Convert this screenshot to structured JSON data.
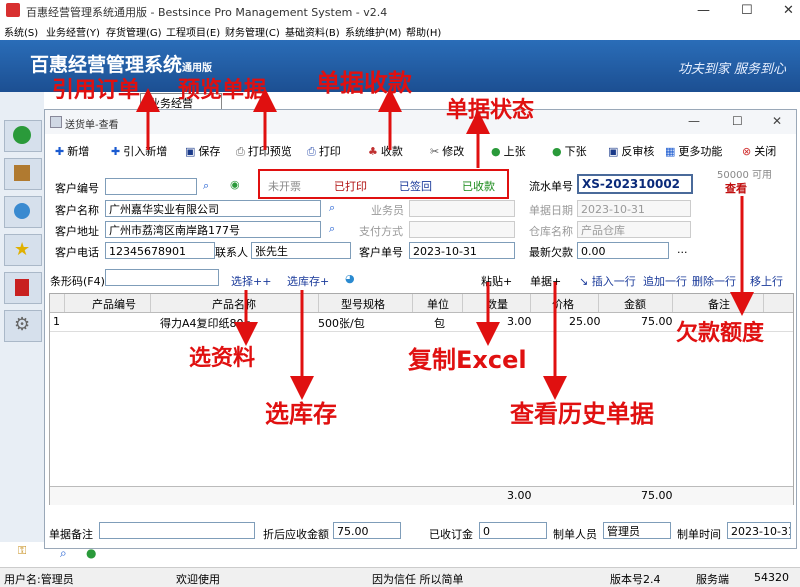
{
  "outer_window": {
    "title": "百惠经营管理系统通用版 - Bestsince Pro Management System - v2.4",
    "menu": [
      "系统(S)",
      "业务经营(Y)",
      "存货管理(G)",
      "工程项目(E)",
      "财务管理(C)",
      "基础资料(B)",
      "系统维护(M)",
      "帮助(H)"
    ],
    "banner_title": "百惠经营管理系统",
    "banner_subtitle": "通用版",
    "slogan": "功夫到家 服务到心",
    "mdi_tab": "业务经营"
  },
  "inner_window": {
    "title": "送货单-查看",
    "toolbar": [
      "新增",
      "引入新增",
      "保存",
      "打印预览",
      "打印",
      "收款",
      "修改",
      "上张",
      "下张",
      "反审核",
      "更多功能",
      "关闭"
    ],
    "status_labels": [
      "未开票",
      "已打印",
      "已签回",
      "已收款"
    ],
    "status_colors": [
      "#888888",
      "#b01010",
      "#1a3a9a",
      "#1a8a1a"
    ],
    "credit_available": "50000 可用",
    "credit_link": "查看"
  },
  "form": {
    "customer_code_label": "客户编号",
    "customer_code": "",
    "customer_name_label": "客户名称",
    "customer_name": "广州嘉华实业有限公司",
    "customer_address_label": "客户地址",
    "customer_address": "广州市荔湾区南岸路177号",
    "customer_phone_label": "客户电话",
    "customer_phone": "12345678901",
    "contact_label": "联系人",
    "contact": "张先生",
    "salesperson_label": "业务员",
    "payment_label": "支付方式",
    "customer_order_label": "客户单号",
    "customer_order": "2023-10-31",
    "serial_label": "流水单号",
    "serial": "XS-202310002",
    "date_label": "单据日期",
    "date": "2023-10-31",
    "warehouse_label": "仓库名称",
    "warehouse": "产品仓库",
    "latest_debt_label": "最新欠款",
    "latest_debt": "0.00",
    "ellipsis": "..."
  },
  "grid_toolbar": {
    "barcode_label": "条形码(F4)",
    "select_data": "选择++",
    "select_stock": "选库存+",
    "paste": "粘贴+",
    "bill": "单据+",
    "insert_row": "插入一行",
    "append_row": "追加一行",
    "delete_row": "删除一行",
    "move_up": "移上行"
  },
  "table": {
    "headers": [
      "产品编号",
      "产品名称",
      "型号规格",
      "单位",
      "数量",
      "价格",
      "金额",
      "备注"
    ],
    "rows": [
      {
        "idx": "1",
        "code": "",
        "name": "得力A4复印纸80g",
        "spec": "500张/包",
        "unit": "包",
        "qty": "3.00",
        "price": "25.00",
        "amount": "75.00",
        "note": ""
      }
    ],
    "total_qty": "3.00",
    "total_amount": "75.00"
  },
  "footer": {
    "remark_label": "单据备注",
    "discount_label": "折后应收金额",
    "discount_value": "75.00",
    "received_label": "已收订金",
    "received_value": "0",
    "maker_label": "制单人员",
    "maker": "管理员",
    "make_time_label": "制单时间",
    "make_time": "2023-10-31"
  },
  "statusbar": {
    "user": "用户名:管理员",
    "welcome": "欢迎使用",
    "motto": "因为信任 所以简单",
    "version": "版本号2.4",
    "service": "服务端",
    "code": "54320"
  },
  "annotations": {
    "import_order": "引用订单",
    "preview": "预览单据",
    "collect": "单据收款",
    "status": "单据状态",
    "select_data": "选资料",
    "select_stock": "选库存",
    "copy_excel": "复制Excel",
    "history": "查看历史单据",
    "credit": "欠款额度"
  },
  "colors": {
    "annotation": "#e01010",
    "banner": "#1f5aa5",
    "serial": "#0a2a7a"
  }
}
